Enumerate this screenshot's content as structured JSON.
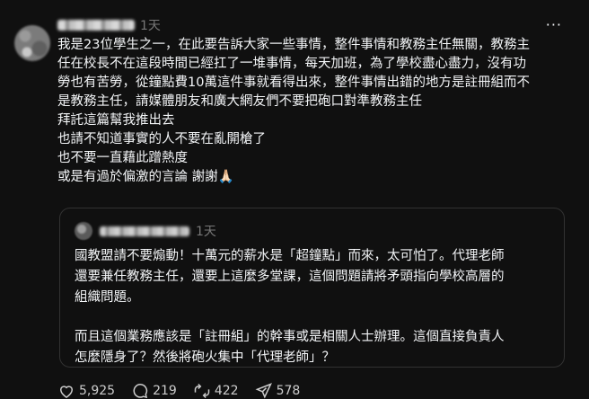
{
  "post": {
    "time": "1天",
    "more": "···",
    "lines": [
      "我是23位學生之一，在此要告訴大家一些事情，整件事情和教務主任無關，教務主",
      "任在校長不在這段時間已經扛了一堆事情，每天加班，為了學校盡心盡力，沒有功",
      "勞也有苦勞，從鐘點費10萬這件事就看得出來，整件事情出錯的地方是註冊組而不",
      "是教務主任，請媒體朋友和廣大網友們不要把砲口對準教務主任",
      "拜託這篇幫我推出去",
      "也請不知道事實的人不要在亂開槍了",
      "也不要一直藉此蹭熱度",
      "或是有過於偏激的言論 謝謝🙏🏻"
    ]
  },
  "quote": {
    "time": "1天",
    "paragraph1": [
      "國教盟請不要煽動！十萬元的薪水是「超鐘點」而來，太可怕了。代理老師",
      "還要兼任教務主任，還要上這麼多堂課，這個問題請將矛頭指向學校高層的",
      "組織問題。"
    ],
    "paragraph2": [
      "而且這個業務應該是「註冊組」的幹事或是相關人士辦理。這個直接負責人",
      "怎麼隱身了？然後將砲火集中「代理老師」？"
    ]
  },
  "actions": {
    "likes": "5,925",
    "comments": "219",
    "reposts": "422",
    "shares": "578"
  }
}
